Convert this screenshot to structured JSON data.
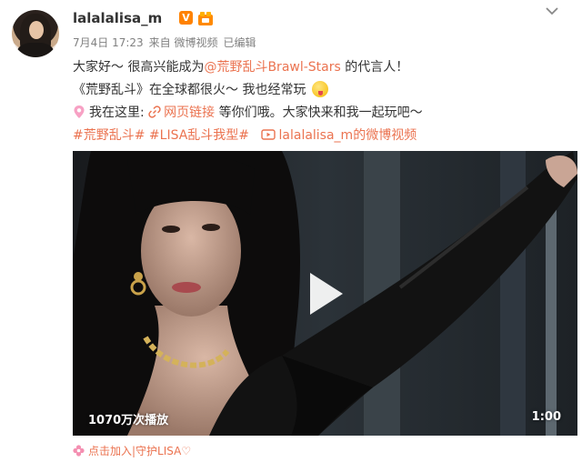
{
  "user": {
    "name": "lalalalisa_m",
    "verified_badge": "V"
  },
  "meta": {
    "date": "7月4日 17:23",
    "source": "来自 微博视频",
    "edited": "已编辑"
  },
  "post": {
    "line1_prefix": "大家好～ 很高兴能成为",
    "line1_mention": "@荒野乱斗Brawl-Stars",
    "line1_suffix": " 的代言人！",
    "line2": "《荒野乱斗》在全球都很火～ 我也经常玩",
    "line3_prefix": "我在这里: ",
    "line3_link": "网页链接",
    "line3_suffix": " 等你们哦。大家快来和我一起玩吧～",
    "tag1": "#荒野乱斗#",
    "tag2": "#LISA乱斗我型#",
    "video_link": "lalalalisa_m的微博视频"
  },
  "video": {
    "views": "1070万次播放",
    "duration": "1:00"
  },
  "footer": {
    "text": "点击加入|守护LISA♡"
  },
  "colors": {
    "accent": "#eb7350",
    "verified": "#ff8200"
  }
}
